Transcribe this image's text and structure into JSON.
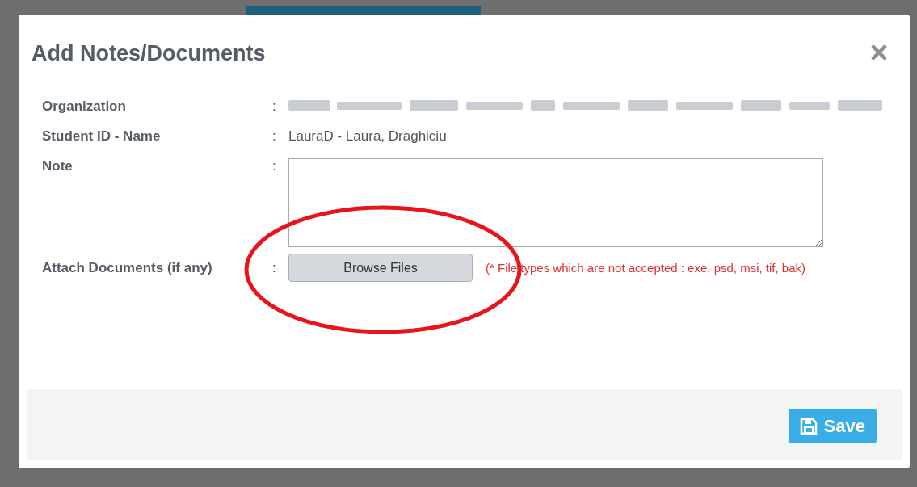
{
  "dialog": {
    "title": "Add Notes/Documents",
    "fields": [
      {
        "kind": "redacted",
        "label": "Organization",
        "separator": ":"
      },
      {
        "kind": "text",
        "label": "Student ID - Name",
        "separator": ":",
        "value": "LauraD - Laura, Draghiciu"
      },
      {
        "kind": "textarea",
        "label": "Note",
        "separator": ":"
      },
      {
        "kind": "file",
        "label": "Attach Documents (if any)",
        "separator": ":",
        "button": "Browse Files",
        "hint": "(* File types which are not accepted : exe, psd, msi, tif, bak)"
      }
    ],
    "save": "Save"
  }
}
